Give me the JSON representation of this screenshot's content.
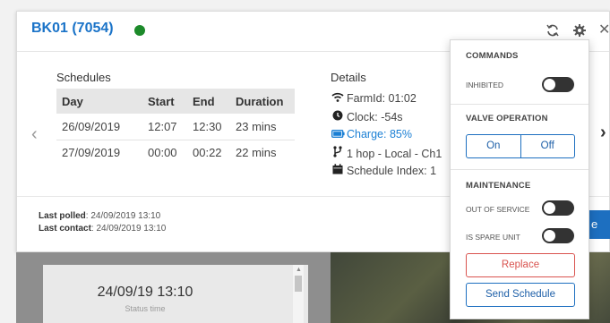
{
  "device": {
    "title": "BK01 (7054)",
    "status_color": "#1c8a2a"
  },
  "header_icons": [
    "refresh-icon",
    "gear-icon",
    "close-icon"
  ],
  "close_glyph": "✕",
  "nav": {
    "prev": "‹",
    "next": "›"
  },
  "schedules": {
    "title": "Schedules",
    "columns": [
      "Day",
      "Start",
      "End",
      "Duration"
    ],
    "rows": [
      [
        "26/09/2019",
        "12:07",
        "12:30",
        "23 mins"
      ],
      [
        "27/09/2019",
        "00:00",
        "00:22",
        "22 mins"
      ]
    ]
  },
  "details": {
    "title": "Details",
    "farm_id": "FarmId: 01:02",
    "clock": "Clock: -54s",
    "charge": "Charge: 85%",
    "hop": "1 hop - Local - Ch1",
    "schedule_index": "Schedule Index: 1"
  },
  "footer": {
    "last_polled_label": "Last polled",
    "last_polled_value": ": 24/09/2019 13:10",
    "last_contact_label": "Last contact",
    "last_contact_value": ": 24/09/2019 13:10",
    "partial_button": "e"
  },
  "status_panel": {
    "time": "24/09/19 13:10",
    "label": "Status time"
  },
  "menu": {
    "commands_heading": "COMMANDS",
    "inhibited_label": "INHIBITED",
    "valve_heading": "VALVE OPERATION",
    "valve_on": "On",
    "valve_off": "Off",
    "maintenance_heading": "MAINTENANCE",
    "out_of_service_label": "OUT OF SERVICE",
    "spare_unit_label": "IS SPARE UNIT",
    "replace_button": "Replace",
    "send_schedule_button": "Send Schedule"
  },
  "colors": {
    "accent": "#1d6fc0",
    "title_blue": "#1a73c8",
    "danger": "#d9534f",
    "charge": "#1a7fd4"
  }
}
